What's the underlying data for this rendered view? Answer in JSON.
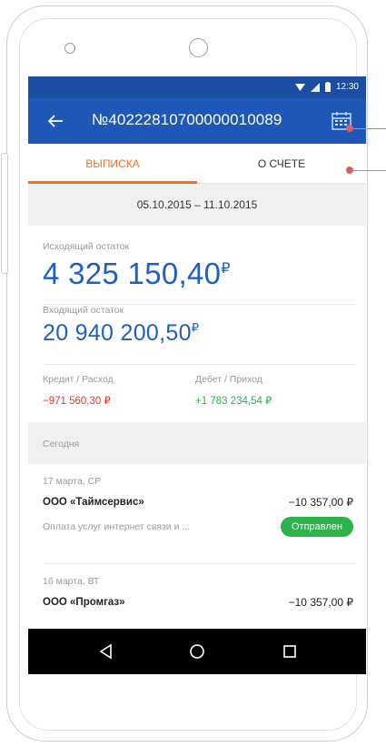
{
  "status_bar": {
    "time": "12:30"
  },
  "app_bar": {
    "account_number": "№40222810700000010089"
  },
  "tabs": [
    {
      "label": "ВЫПИСКА",
      "active": true
    },
    {
      "label": "О СЧЕТЕ",
      "active": false
    }
  ],
  "statement": {
    "date_range": "05.10.2015 – 11.10.2015",
    "closing_balance_label": "Исходящий остаток",
    "closing_balance": "4 325 150,40",
    "opening_balance_label": "Входящий остаток",
    "opening_balance": "20 940 200,50",
    "currency_symbol": "₽",
    "credit_label": "Кредит / Расход",
    "credit_value": "−971 560,30 ₽",
    "debit_label": "Дебет / Приход",
    "debit_value": "+1 783 234,54 ₽"
  },
  "section_label": "Сегодня",
  "transactions": [
    {
      "date": "17 марта, СР",
      "name": "ООО «Таймсервис»",
      "amount": "−10 357,00 ₽",
      "description": "Оплата услуг интернет связи и ...",
      "status": "Отправлен"
    },
    {
      "date": "16 марта, ВТ",
      "name": "ООО «Промгаз»",
      "amount": "−10 357,00 ₽"
    }
  ],
  "colors": {
    "primary": "#1f57b6",
    "status_bar": "#1b4ea3",
    "accent": "#f0712a",
    "amount_blue": "#1f5fc5",
    "negative": "#e8322c",
    "positive": "#2bb24c",
    "badge": "#2db34a"
  },
  "icons": {
    "back": "arrow-left-icon",
    "calendar": "calendar-icon",
    "wifi": "wifi-icon",
    "signal": "signal-icon",
    "battery": "battery-icon",
    "nav_back": "nav-back-icon",
    "nav_home": "nav-home-icon",
    "nav_recents": "nav-recents-icon"
  }
}
